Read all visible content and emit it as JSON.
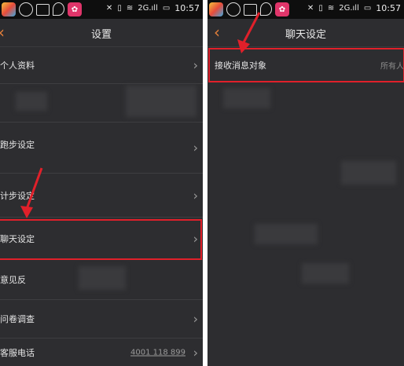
{
  "left": {
    "status_time": "10:57",
    "network": "2G.ıll",
    "nav_title": "设置",
    "back_icon": "chevron-left-icon",
    "rows": [
      {
        "label": "个人资料"
      },
      {
        "label": ""
      },
      {
        "label": "跑步设定"
      },
      {
        "label": "计步设定"
      },
      {
        "label": "聊天设定"
      },
      {
        "label": "意见反"
      },
      {
        "label": "问卷调查"
      },
      {
        "label": "客服电话",
        "value": "4001 118 899"
      }
    ]
  },
  "right": {
    "status_time": "10:57",
    "network": "2G.ıll",
    "nav_title": "聊天设定",
    "rows": [
      {
        "label": "接收消息对象",
        "value": "所有人"
      }
    ]
  },
  "colors": {
    "accent": "#e5803a",
    "highlight": "#e0202a",
    "background": "#2d2d30"
  }
}
